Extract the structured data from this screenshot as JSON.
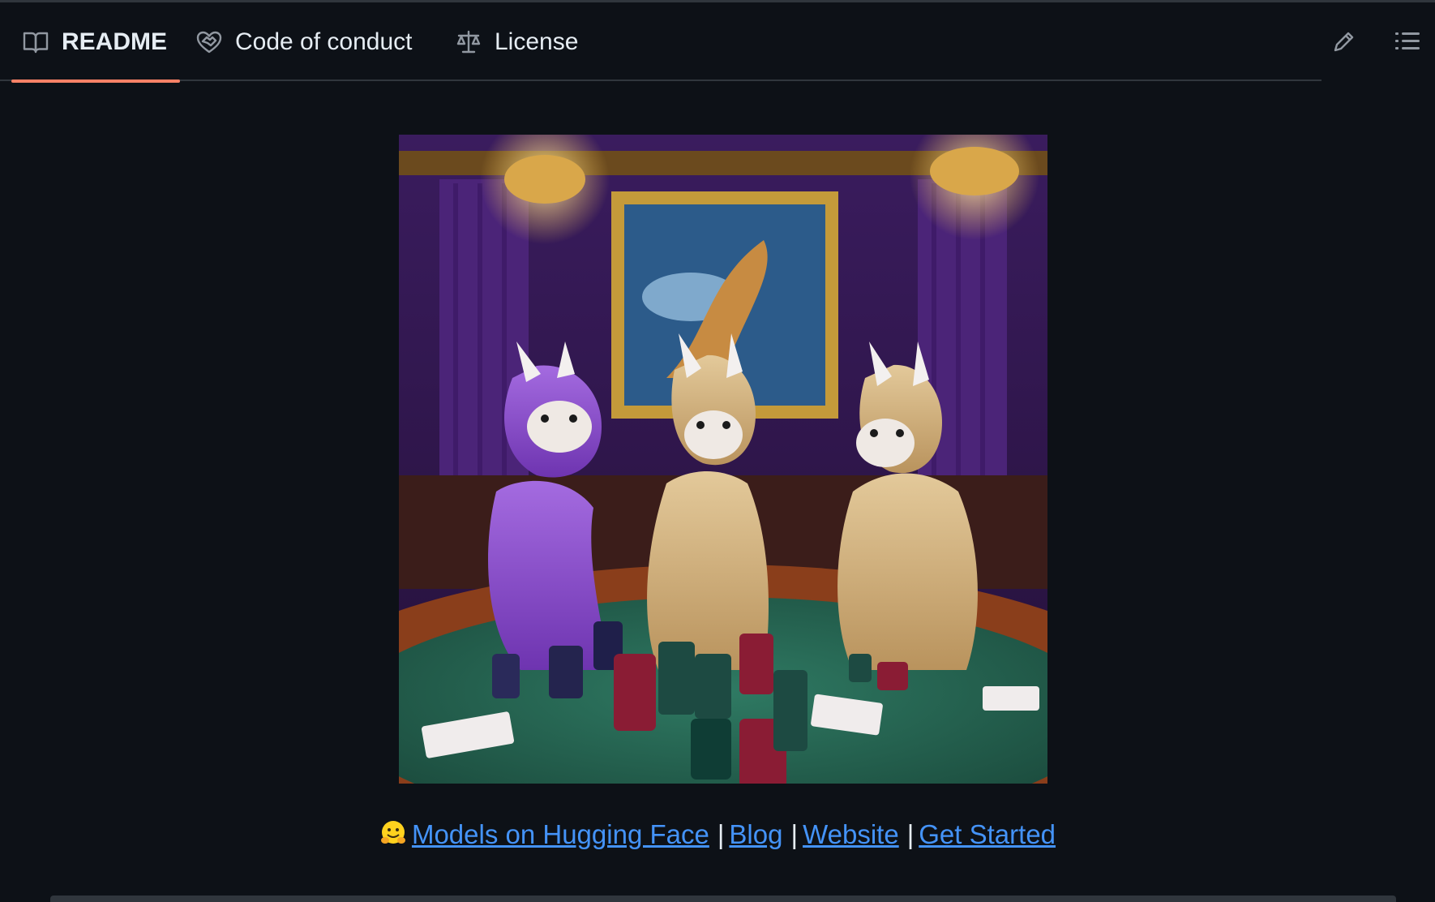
{
  "tabs": [
    {
      "label": "README",
      "icon": "book-icon",
      "active": true
    },
    {
      "label": "Code of conduct",
      "icon": "code-of-conduct-icon",
      "active": false
    },
    {
      "label": "License",
      "icon": "law-scale-icon",
      "active": false
    }
  ],
  "toolbar": {
    "edit_icon": "pencil-icon",
    "toc_icon": "list-icon"
  },
  "readme": {
    "image_alt": "Three llamas playing poker",
    "links": [
      {
        "label": "Models on Hugging Face"
      },
      {
        "label": "Blog"
      },
      {
        "label": "Website"
      },
      {
        "label": "Get Started"
      }
    ],
    "separator": "|"
  },
  "colors": {
    "background": "#0d1117",
    "link": "#4493f8",
    "active_tab_underline": "#f78166",
    "border": "#30363d"
  }
}
